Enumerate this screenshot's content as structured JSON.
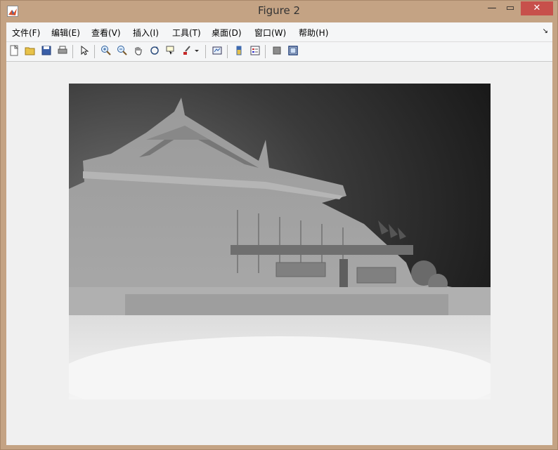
{
  "window": {
    "title": "Figure 2"
  },
  "controls": {
    "minimize": "—",
    "maximize": "▭",
    "close": "✕"
  },
  "menu": [
    {
      "label": "文件(F)",
      "icon": ""
    },
    {
      "label": "编辑(E)"
    },
    {
      "label": "查看(V)"
    },
    {
      "label": "插入(I)"
    },
    {
      "label": "工具(T)"
    },
    {
      "label": "桌面(D)"
    },
    {
      "label": "窗口(W)"
    },
    {
      "label": "帮助(H)"
    }
  ],
  "menu_overflow": "↘",
  "toolbar": {
    "icons": [
      "new-figure-icon",
      "open-file-icon",
      "save-icon",
      "print-icon",
      "select-arrow-icon",
      "zoom-in-icon",
      "zoom-out-icon",
      "pan-hand-icon",
      "rotate-3d-icon",
      "data-cursor-icon",
      "brush-icon",
      "link-plot-icon",
      "colorbar-icon",
      "legend-icon",
      "hide-plot-tools-icon",
      "show-plot-tools-icon"
    ]
  },
  "image": {
    "description_colors": {
      "sky_dark": "#1c1c1c",
      "building": "#8a8a8a",
      "ground": "#f2f2f2"
    }
  }
}
